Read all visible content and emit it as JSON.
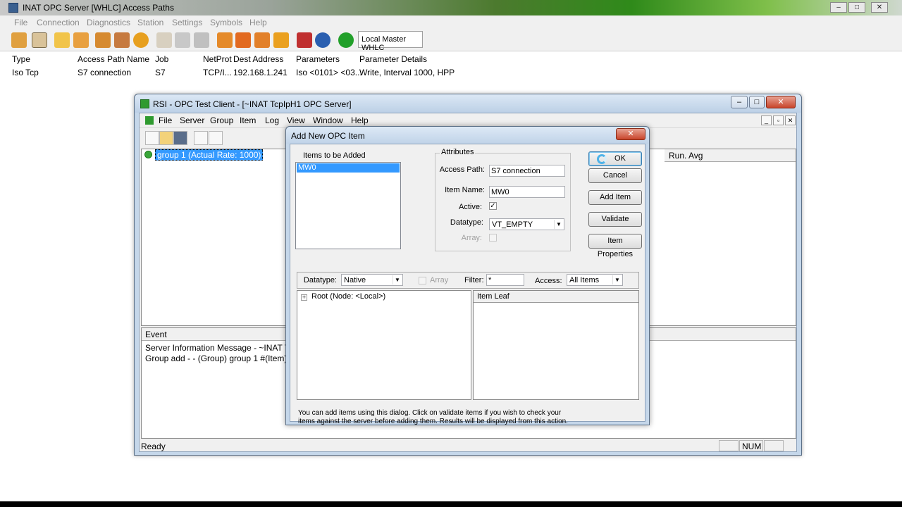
{
  "main_window": {
    "title": "INAT OPC Server [WHLC] Access Paths",
    "menu": [
      "File",
      "Connection",
      "Diagnostics",
      "Station",
      "Settings",
      "Symbols",
      "Help"
    ],
    "station_select": "Local Master WHLC",
    "columns": [
      "Type",
      "Access Path Name",
      "Job",
      "NetProt",
      "Dest Address",
      "Parameters",
      "Parameter Details"
    ],
    "row": {
      "type": "Iso Tcp",
      "access_path_name": "S7 connection",
      "job": "S7",
      "netprot": "TCP/I...",
      "dest_address": "192.168.1.241",
      "parameters": "Iso <0101> <03...",
      "details": "Write, Interval 1000, HPP"
    }
  },
  "rsi_window": {
    "title": "RSI - OPC Test Client - [~INAT TcpIpH1 OPC Server]",
    "menu": [
      "File",
      "Server",
      "Group",
      "Item",
      "Log",
      "View",
      "Window",
      "Help"
    ],
    "group_item": "group 1 (Actual Rate: 1000)",
    "run_avg_header": "Run. Avg",
    "event_header": "Event",
    "events": [
      "Server Information Message - ~INAT TcpIp",
      "Group add -  - (Group) group 1 #(Item) 0"
    ],
    "status": "Ready",
    "status_num": "NUM"
  },
  "dialog": {
    "title": "Add New OPC Item",
    "items_to_add_label": "Items to be Added",
    "items": [
      "MW0"
    ],
    "attributes_label": "Attributes",
    "access_path_label": "Access Path:",
    "access_path_value": "S7 connection",
    "item_name_label": "Item Name:",
    "item_name_value": "MW0",
    "active_label": "Active:",
    "datatype_label": "Datatype:",
    "datatype_value": "VT_EMPTY",
    "array_label": "Array:",
    "buttons": {
      "ok": "OK",
      "cancel": "Cancel",
      "add_item": "Add Item",
      "validate": "Validate",
      "item_properties": "Item Properties"
    },
    "filter_bar": {
      "datatype_label": "Datatype:",
      "datatype_value": "Native",
      "array_label": "Array",
      "filter_label": "Filter:",
      "filter_value": "*",
      "access_label": "Access:",
      "access_value": "All Items"
    },
    "root_node": "Root (Node: <Local>)",
    "item_leaf_header": "Item Leaf",
    "help_line1": "You can add items using this dialog.  Click on validate items if you wish to check your",
    "help_line2": "items against the server before adding them.  Results will be displayed from this action."
  },
  "colors": {
    "selection": "#3399ff",
    "status_green": "#3aa63a",
    "window_frame": "#c5d7ea",
    "close_red": "#c8442a"
  }
}
